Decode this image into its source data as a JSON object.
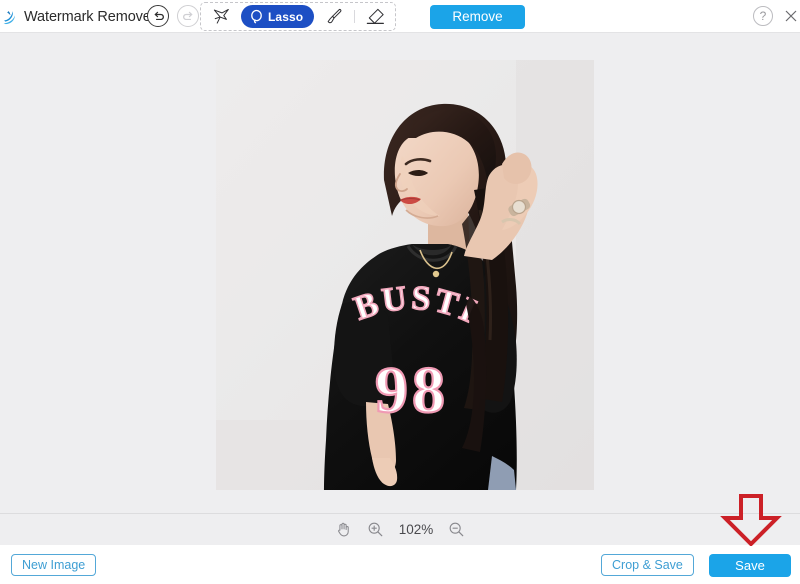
{
  "app": {
    "title": "Watermark Remover",
    "logo_icon": "wave-logo-icon",
    "accent_blue": "#1ba4e8",
    "tool_active_blue": "#1d4fc4",
    "canvas_bg": "#eeeef0",
    "annotation_red": "#cc2027"
  },
  "topbar": {
    "history": {
      "undo": {
        "icon": "undo-arrow-icon",
        "enabled": true
      },
      "redo": {
        "icon": "redo-arrow-icon",
        "enabled": false
      }
    },
    "tools": [
      {
        "name": "polygon-lasso",
        "icon": "polygon-lasso-icon",
        "label": "",
        "active": false
      },
      {
        "name": "lasso",
        "icon": "lasso-icon",
        "label": "Lasso",
        "active": true
      },
      {
        "name": "brush",
        "icon": "brush-icon",
        "label": "",
        "active": false
      },
      {
        "name": "eraser",
        "icon": "eraser-icon",
        "label": "",
        "active": false
      }
    ],
    "remove_label": "Remove",
    "help_label": "?",
    "close_icon": "close-x-icon"
  },
  "canvas": {
    "image": {
      "alt": "Woman in black t-shirt with BUSTI 98 print on light gray background",
      "shirt_text_top": "BUSTI",
      "shirt_text_number": "98",
      "background_color": "#ebe9e9",
      "shirt_color": "#131313"
    }
  },
  "zoombar": {
    "pan_icon": "hand-pan-icon",
    "zoom_in_icon": "zoom-in-icon",
    "zoom_level": "102%",
    "zoom_out_icon": "zoom-out-icon"
  },
  "bottombar": {
    "new_image_label": "New Image",
    "crop_save_label": "Crop & Save",
    "save_label": "Save"
  },
  "annotation": {
    "arrow_icon": "red-down-arrow-icon",
    "points_to": "Save"
  }
}
